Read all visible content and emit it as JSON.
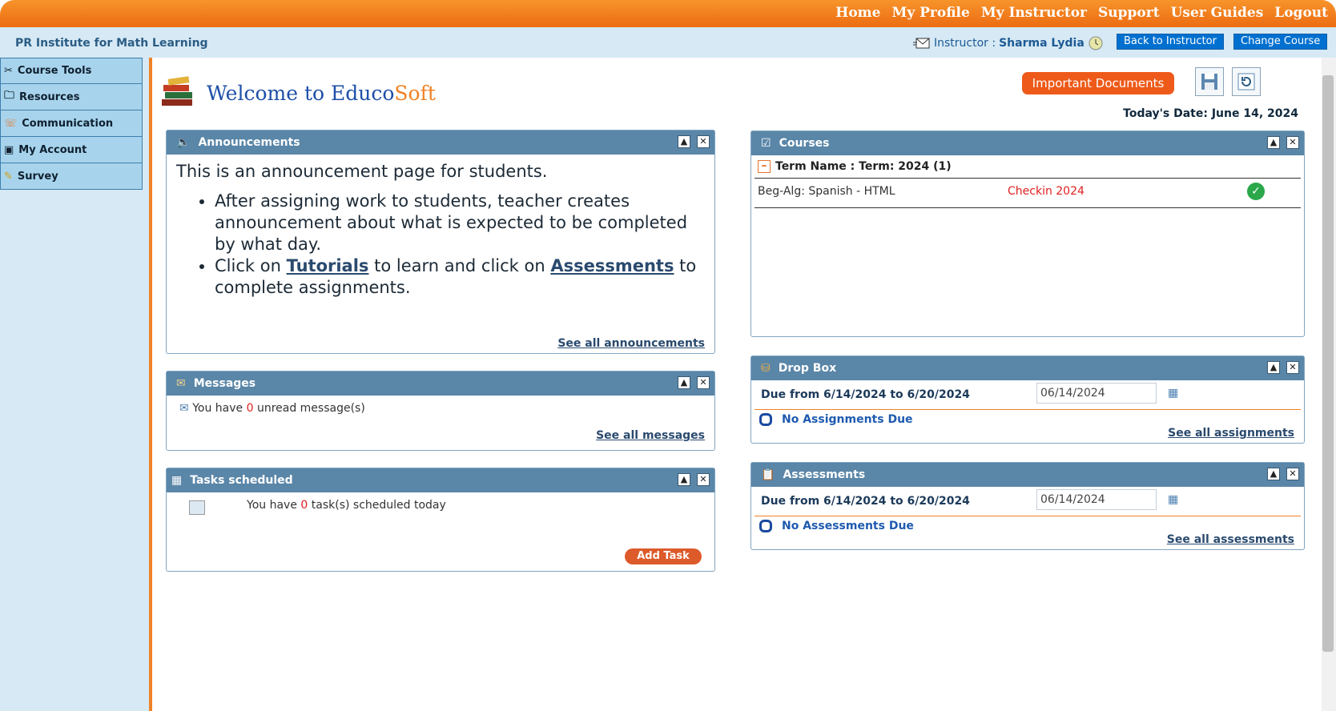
{
  "topnav": [
    "Home",
    "My Profile",
    "My Instructor",
    "Support",
    "User Guides",
    "Logout"
  ],
  "org_name": "PR Institute for Math Learning",
  "instructor": {
    "label": "Instructor :",
    "name": "Sharma Lydia"
  },
  "buttons": {
    "back": "Back to Instructor",
    "change": "Change Course",
    "important": "Important Documents",
    "add_task": "Add Task"
  },
  "sidebar": [
    "Course Tools",
    "Resources",
    "Communication",
    "My Account",
    "Survey"
  ],
  "welcome": {
    "prefix": "Welcome to Educo",
    "suffix": "Soft"
  },
  "today": "Today's Date: June 14, 2024",
  "announcements": {
    "title": "Announcements",
    "intro": "This is an announcement page for students.",
    "bullet1": "After assigning work to students, teacher creates announcement about what is expected to be completed by what day.",
    "bullet2_a": "Click on ",
    "tutorials": "Tutorials",
    "bullet2_b": " to learn and click on ",
    "assessments": "Assessments",
    "bullet2_c": " to complete assignments.",
    "see_all": "See all announcements"
  },
  "messages": {
    "title": "Messages",
    "pre": "You have ",
    "count": "0",
    "post": " unread message(s)",
    "see_all": "See all messages"
  },
  "tasks": {
    "title": "Tasks scheduled",
    "pre": "You have ",
    "count": "0",
    "post": " task(s) scheduled today"
  },
  "courses": {
    "title": "Courses",
    "term": "Term Name : Term: 2024 (1)",
    "course": "Beg-Alg: Spanish - HTML",
    "checkin": "Checkin 2024"
  },
  "dropbox": {
    "title": "Drop Box",
    "due": "Due from 6/14/2024 to 6/20/2024",
    "date": "06/14/2024",
    "none": "No Assignments Due",
    "see_all": "See all assignments"
  },
  "assess": {
    "title": "Assessments",
    "due": "Due from 6/14/2024 to 6/20/2024",
    "date": "06/14/2024",
    "none": "No Assessments Due",
    "see_all": "See all assessments"
  },
  "colors": {
    "orange": "#f08226",
    "panel_head": "#5a86a8",
    "sidebar": "#a7d4ec"
  }
}
